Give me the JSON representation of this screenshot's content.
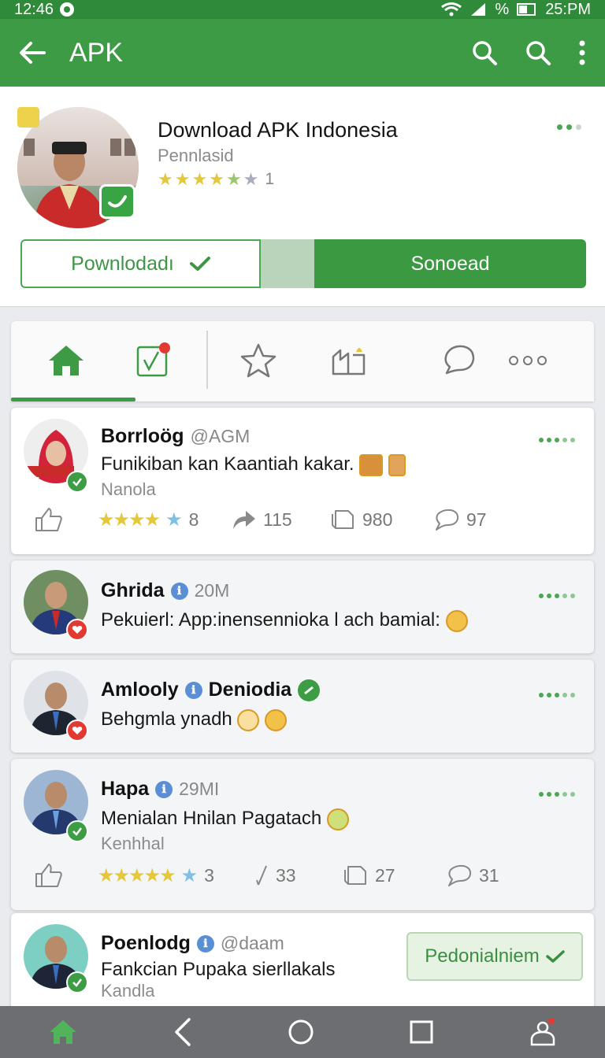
{
  "status_bar": {
    "time_left": "12:46",
    "battery_text": "%",
    "time_right": "25:PM"
  },
  "app_bar": {
    "title": "APK"
  },
  "app_header": {
    "title": "Download APK Indonesia",
    "subtitle": "Pennlasid",
    "rating_count": "1",
    "outline_button_label": "Pownlodadı",
    "filled_button_label": "Sonoead"
  },
  "posts": [
    {
      "name": "Borrloög",
      "handle": "@AGM",
      "text": "Funikiban kan Kaantiah kakar.",
      "subtext": "Nanola",
      "stats": {
        "rating_count": "8",
        "shares": "115",
        "reposts": "980",
        "replies": "97"
      }
    },
    {
      "name": "Ghrida",
      "handle": "20M",
      "text": "Pekuierl: App:inensennioka l ach bamial:"
    },
    {
      "name": "Amlooly",
      "name2": "Deniodia",
      "text": "Behgmla ynadh"
    },
    {
      "name": "Hapa",
      "handle": "29MI",
      "text": "Menialan Hnilan Pagatach",
      "subtext": "Kenhhal",
      "stats": {
        "rating_count": "3",
        "shares": "33",
        "reposts": "27",
        "replies": "31"
      }
    },
    {
      "name": "Poenlodg",
      "handle": "@daam",
      "text": "Fankcian Pupaka sierllakals",
      "subtext": "Kandla",
      "button_label": "Pedonialniem"
    }
  ],
  "colors": {
    "primary": "#3d9b45",
    "primary_dark": "#2f8a3a",
    "star": "#e4c73b"
  },
  "icons": [
    "back-arrow-icon",
    "search-icon",
    "overflow-menu-icon",
    "home-icon",
    "checklist-icon",
    "star-icon",
    "notification-box-icon",
    "chat-bubble-icon",
    "more-horizontal-icon",
    "thumbs-up-icon",
    "share-icon",
    "repost-icon",
    "reply-icon",
    "nav-back-icon",
    "nav-home-circle-icon",
    "nav-recents-icon",
    "profile-icon"
  ]
}
